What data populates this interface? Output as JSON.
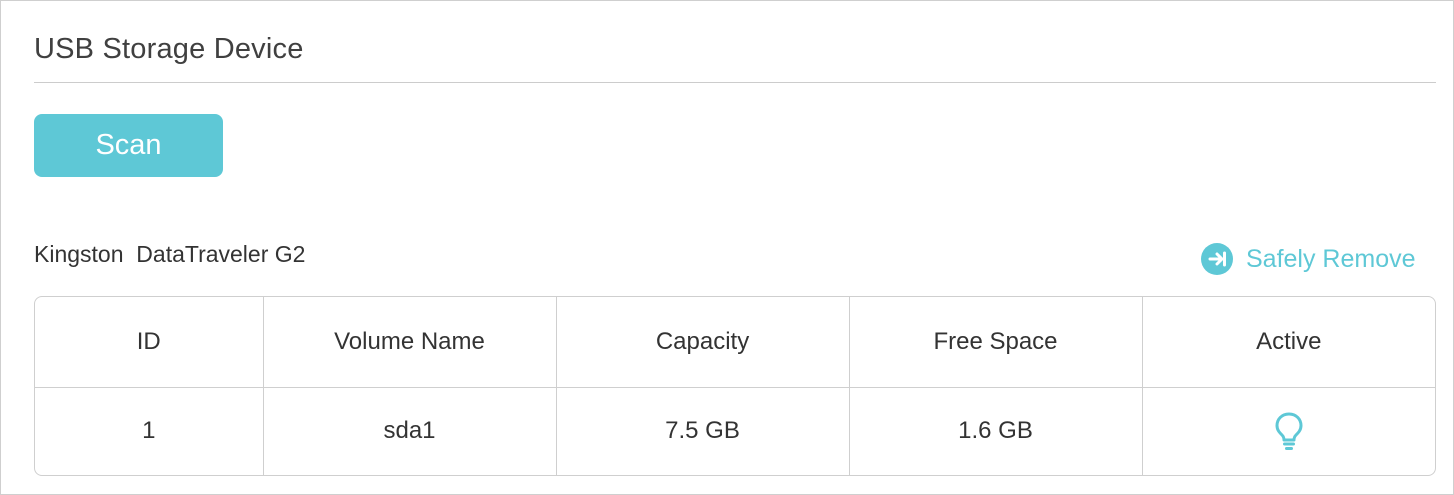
{
  "panel": {
    "title": "USB Storage Device"
  },
  "toolbar": {
    "scan_label": "Scan"
  },
  "device": {
    "name": "Kingston  DataTraveler G2",
    "remove_label": "Safely Remove",
    "remove_icon": "arrow-right-circle-icon"
  },
  "table": {
    "headers": [
      "ID",
      "Volume Name",
      "Capacity",
      "Free Space",
      "Active"
    ],
    "rows": [
      {
        "id": "1",
        "volume_name": "sda1",
        "capacity": "7.5 GB",
        "free_space": "1.6 GB",
        "active_icon": "lightbulb-icon"
      }
    ]
  },
  "colors": {
    "accent": "#5ec8d6",
    "border": "#cfcfcf",
    "text": "#333333"
  }
}
